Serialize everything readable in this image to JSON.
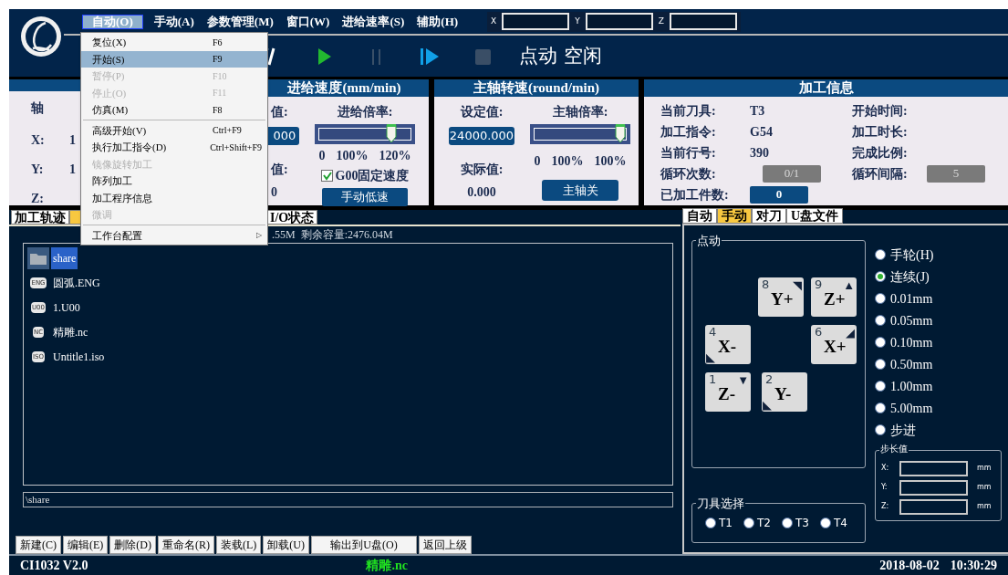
{
  "menu_bar": [
    {
      "label": "自动(O)",
      "selected": true
    },
    {
      "label": "手动(A)",
      "selected": false
    },
    {
      "label": "参数管理(M)",
      "selected": false
    },
    {
      "label": "窗口(W)",
      "selected": false
    },
    {
      "label": "进给速率(S)",
      "selected": false
    },
    {
      "label": "辅助(H)",
      "selected": false
    }
  ],
  "coordinate_fields": [
    {
      "label": "X"
    },
    {
      "label": "Y"
    },
    {
      "label": "Z"
    }
  ],
  "toolbar": {
    "buttons": [
      {
        "kind": "feed",
        "disabled": false
      },
      {
        "kind": "play",
        "disabled": false
      },
      {
        "kind": "pause",
        "disabled": true
      },
      {
        "kind": "step",
        "disabled": false
      },
      {
        "kind": "stop",
        "disabled": true
      }
    ],
    "status": "点动 空闲"
  },
  "auto_menu": [
    {
      "label": "复位(X)",
      "shortcut": "F6",
      "disabled": false,
      "selected": false
    },
    {
      "label": "开始(S)",
      "shortcut": "F9",
      "disabled": false,
      "selected": true
    },
    {
      "label": "暂停(P)",
      "shortcut": "F10",
      "disabled": true,
      "selected": false
    },
    {
      "label": "停止(O)",
      "shortcut": "F11",
      "disabled": true,
      "selected": false
    },
    {
      "label": "仿真(M)",
      "shortcut": "F8",
      "disabled": false,
      "selected": false
    },
    {
      "kind": "separator"
    },
    {
      "label": "高级开始(V)",
      "shortcut": "Ctrl+F9",
      "disabled": false,
      "selected": false
    },
    {
      "label": "执行加工指令(D)",
      "shortcut": "Ctrl+Shift+F9",
      "disabled": false,
      "selected": false
    },
    {
      "label": "镜像旋转加工",
      "disabled": true,
      "selected": false
    },
    {
      "label": "阵列加工",
      "disabled": false,
      "selected": false
    },
    {
      "label": "加工程序信息",
      "disabled": false,
      "selected": false
    },
    {
      "label": "微调",
      "disabled": true,
      "selected": false
    },
    {
      "kind": "separator"
    },
    {
      "label": "工作台配置",
      "disabled": false,
      "selected": false,
      "submenu_mark": "▷"
    }
  ],
  "axis_panel": {
    "header": "轴",
    "rows": [
      {
        "axis": "X:",
        "value": "1"
      },
      {
        "axis": "Y:",
        "value": "1"
      },
      {
        "axis": "Z:"
      }
    ]
  },
  "feed_panel": {
    "title": "进给速度(mm/min)",
    "set_label": "值:",
    "set_value": "000",
    "actual_label": "值:",
    "actual_value": "0",
    "override_label": "进给倍率:",
    "level": 0.83,
    "scale": [
      "0",
      "100%",
      "120%"
    ],
    "g00_fixed": {
      "label": "G00固定速度",
      "checked": true
    },
    "button": "手动低速"
  },
  "spindle_panel": {
    "title": "主轴转速(round/min)",
    "set_label": "设定值:",
    "set_value": "24000.000",
    "actual_label": "实际值:",
    "actual_value": "0.000",
    "override_label": "主轴倍率:",
    "level": 1,
    "scale": [
      "0",
      "100%",
      "100%"
    ],
    "button": "主轴关"
  },
  "info_panel": {
    "title": "加工信息",
    "left_fields": [
      {
        "label": "当前刀具:",
        "value": "T3",
        "kind": "text"
      },
      {
        "label": "加工指令:",
        "value": "G54",
        "kind": "text"
      },
      {
        "label": "当前行号:",
        "value": "390",
        "kind": "text"
      },
      {
        "label": "循环次数:",
        "value": "0/1",
        "kind": "greybox"
      },
      {
        "label": "已加工件数:",
        "value": "0",
        "kind": "bluebox"
      }
    ],
    "right_fields": [
      {
        "label": "开始时间:"
      },
      {
        "label": "加工时长:"
      },
      {
        "label": "完成比例:"
      },
      {
        "label": "循环间隔:",
        "value": "5",
        "kind": "greybox"
      }
    ]
  },
  "file_panel": {
    "tabs": [
      {
        "label": "加工轨迹",
        "selected": false
      },
      {
        "selected": true
      },
      {
        "label": "I/O状态",
        "selected": false
      }
    ],
    "storage_text": ".55M  剩余容量:2476.04M",
    "files": [
      {
        "name": "share",
        "kind": "folder",
        "selected": true
      },
      {
        "name": "圆弧.ENG",
        "kind": "file",
        "badge": "ENG",
        "selected": false
      },
      {
        "name": "1.U00",
        "kind": "file",
        "badge": "U00",
        "selected": false
      },
      {
        "name": "精雕.nc",
        "kind": "file",
        "badge": "NC",
        "selected": false
      },
      {
        "name": "Untitle1.iso",
        "kind": "file",
        "badge": "ISO",
        "selected": false
      }
    ],
    "path": "\\share",
    "buttons": [
      "新建(C)",
      "编辑(E)",
      "删除(D)",
      "重命名(R)",
      "装载(L)",
      "卸载(U)",
      "输出到U盘(O)",
      "返回上级"
    ]
  },
  "manual_panel": {
    "tabs": [
      {
        "label": "自动",
        "selected": false
      },
      {
        "label": "手动",
        "selected": true
      },
      {
        "label": "对刀",
        "selected": false
      },
      {
        "label": "U盘文件",
        "selected": false
      }
    ],
    "jog_title": "点动",
    "keys": [
      {
        "number": "8",
        "label": "Y+",
        "mark": "◥"
      },
      {
        "number": "9",
        "label": "Z+",
        "mark": "▲"
      },
      {
        "number": "4",
        "label": "X-",
        "mark": "◣"
      },
      {
        "number": "6",
        "label": "X+",
        "mark": "◢"
      },
      {
        "number": "1",
        "label": "Z-",
        "mark": "▼"
      },
      {
        "number": "2",
        "label": "Y-",
        "mark": "◣"
      }
    ],
    "modes": [
      {
        "label": "手轮(H)",
        "selected": false
      },
      {
        "label": "连续(J)",
        "selected": true
      },
      {
        "label": "0.01mm",
        "selected": false
      },
      {
        "label": "0.05mm",
        "selected": false
      },
      {
        "label": "0.10mm",
        "selected": false
      },
      {
        "label": "0.50mm",
        "selected": false
      },
      {
        "label": "1.00mm",
        "selected": false
      },
      {
        "label": "5.00mm",
        "selected": false
      },
      {
        "label": "步进",
        "selected": false
      }
    ],
    "step_title": "步长值",
    "step_fields": [
      {
        "axis": "X:",
        "unit": "mm"
      },
      {
        "axis": "Y:",
        "unit": "mm"
      },
      {
        "axis": "Z:",
        "unit": "mm"
      }
    ],
    "tool_title": "刀具选择",
    "tools": [
      {
        "label": "T1",
        "selected": false
      },
      {
        "label": "T2",
        "selected": false
      },
      {
        "label": "T3",
        "selected": false
      },
      {
        "label": "T4",
        "selected": false
      }
    ]
  },
  "status_bar": {
    "version": "CI1032 V2.0",
    "file": "精雕.nc",
    "date": "2018-08-02",
    "time": "10:30:29"
  }
}
